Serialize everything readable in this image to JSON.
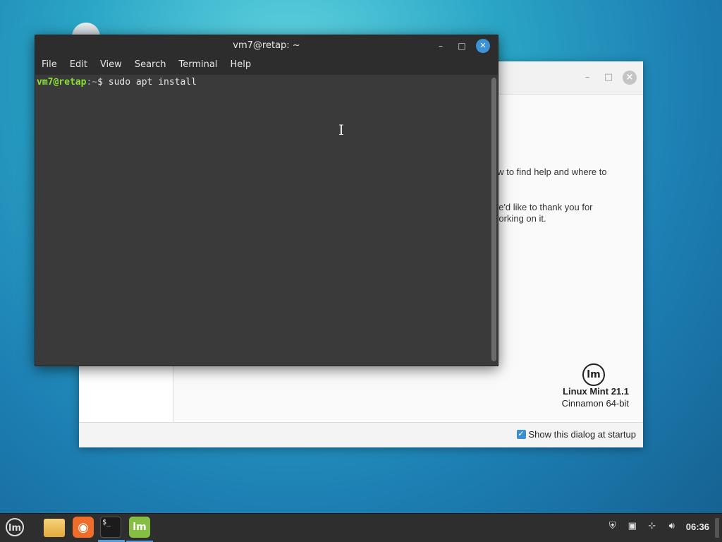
{
  "terminal": {
    "title": "vm7@retap: ~",
    "menu": [
      "File",
      "Edit",
      "View",
      "Search",
      "Terminal",
      "Help"
    ],
    "prompt_user": "vm7@retap",
    "prompt_path": ":~",
    "prompt_symbol": "$",
    "command": " sudo apt install"
  },
  "welcome": {
    "text_line1": "ow to find help and where to",
    "text_line2": "t, we'd like to thank you for",
    "text_line3": "working on it.",
    "version_name": "Linux Mint 21.1",
    "edition": "Cinnamon 64-bit",
    "show_at_startup_label": "Show this dialog at startup",
    "show_at_startup_checked": true
  },
  "taskbar": {
    "clock": "06:36",
    "terminal_icon_text": "$_",
    "accent_color": "#4d9de0"
  }
}
